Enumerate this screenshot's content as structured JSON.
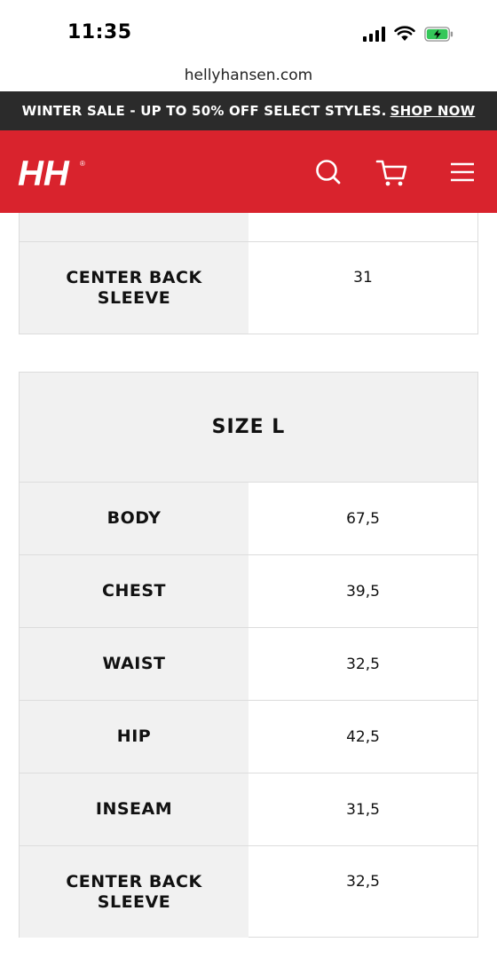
{
  "status_bar": {
    "time": "11:35"
  },
  "browser": {
    "url": "hellyhansen.com"
  },
  "promo": {
    "text": "WINTER SALE - UP TO 50% OFF SELECT STYLES.",
    "link": "SHOP NOW"
  },
  "header": {
    "logo": "HH",
    "icons": [
      "search-icon",
      "cart-icon",
      "menu-icon"
    ],
    "brand_color": "#d9232d"
  },
  "tables": {
    "previous": {
      "rows": [
        {
          "label": "",
          "value": ""
        },
        {
          "label": "CENTER BACK SLEEVE",
          "value": "31"
        }
      ]
    },
    "size_l": {
      "title": "SIZE L",
      "rows": [
        {
          "label": "BODY",
          "value": "67,5"
        },
        {
          "label": "CHEST",
          "value": "39,5"
        },
        {
          "label": "WAIST",
          "value": "32,5"
        },
        {
          "label": "HIP",
          "value": "42,5"
        },
        {
          "label": "INSEAM",
          "value": "31,5"
        },
        {
          "label": "CENTER BACK SLEEVE",
          "value": "32,5"
        }
      ]
    }
  }
}
